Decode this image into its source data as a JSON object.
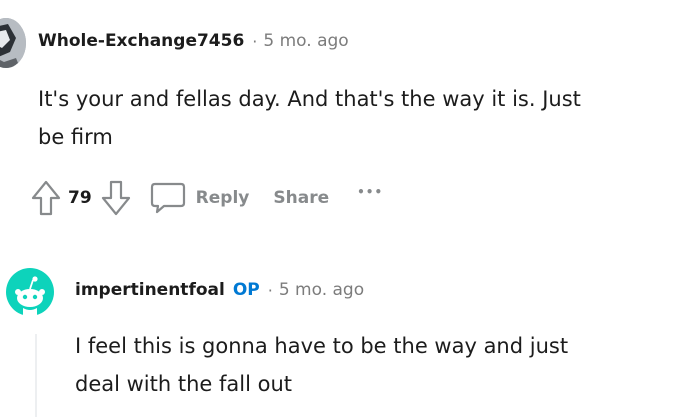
{
  "comment1": {
    "author": "Whole-Exchange7456",
    "separator": "·",
    "time": "5 mo. ago",
    "text_lines": [
      "It's your and fellas day. And that's the way it is. Just",
      "be firm"
    ],
    "score": "79",
    "reply_label": "Reply",
    "share_label": "Share",
    "more_label": "•••"
  },
  "comment2": {
    "author": "impertinentfoal",
    "op_badge": "OP",
    "separator": "·",
    "time": "5 mo. ago",
    "text_lines": [
      "I feel this is gonna have to be the way and just",
      "deal with the fall out"
    ]
  },
  "colors": {
    "text": "#1c1c1c",
    "meta": "#7c7c7c",
    "action": "#878a8c",
    "op": "#0079d3",
    "snoo_avatar_bg": "#0dd3bb"
  },
  "icons": [
    "user-avatar-icon",
    "upvote-arrow-icon",
    "downvote-arrow-icon",
    "comment-bubble-icon",
    "more-options-icon",
    "snoo-avatar-icon"
  ]
}
